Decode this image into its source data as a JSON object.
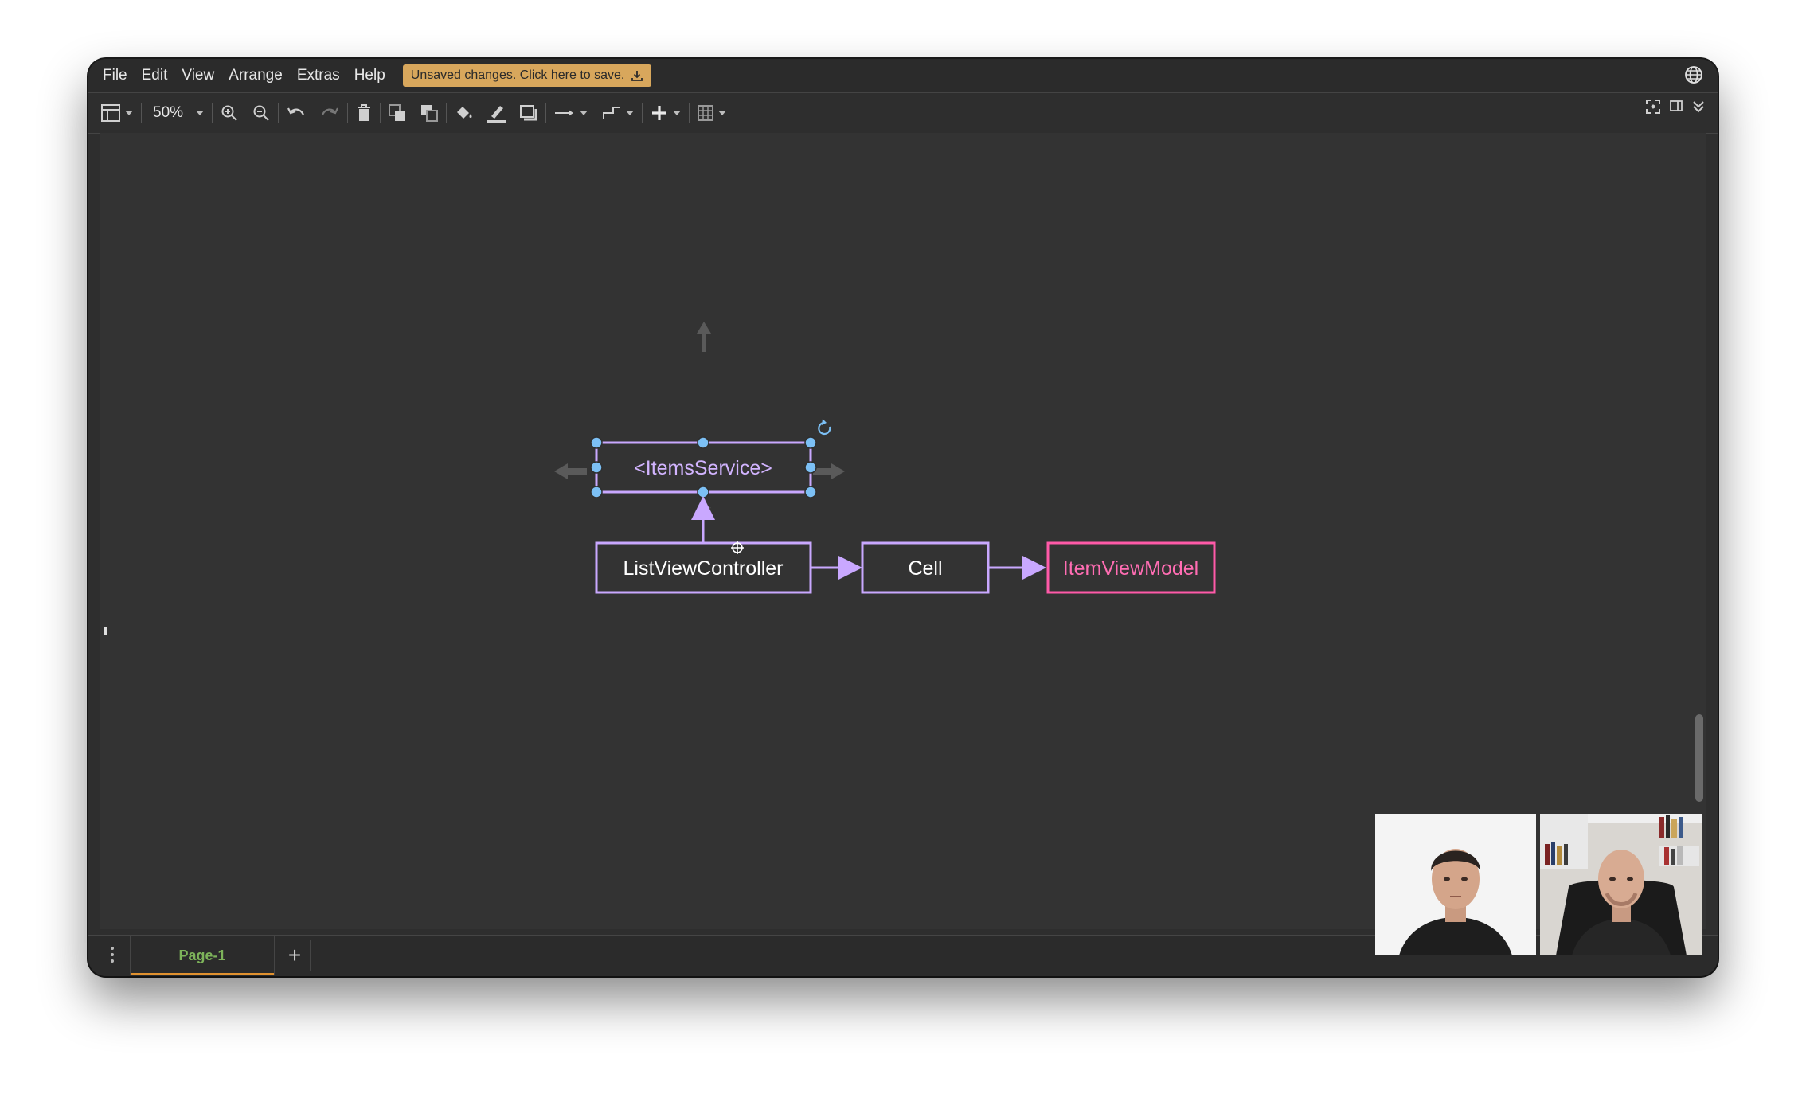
{
  "menubar": {
    "items": [
      "File",
      "Edit",
      "View",
      "Arrange",
      "Extras",
      "Help"
    ],
    "save_banner": "Unsaved changes. Click here to save."
  },
  "toolbar": {
    "zoom": "50%"
  },
  "diagram": {
    "nodes": {
      "items_service": "<ItemsService>",
      "list_view_controller": "ListViewController",
      "cell": "Cell",
      "item_view_model": "ItemViewModel"
    }
  },
  "pages": {
    "tabs": [
      "Page-1"
    ],
    "add_label": "+"
  },
  "colors": {
    "accent_purple": "#c9a8ff",
    "accent_pink": "#ff5aa8",
    "selection_handle": "#7cc0f5",
    "save_banner": "#d8a75c",
    "page_tab_text": "#7db35a",
    "page_tab_underline": "#e0912f"
  }
}
